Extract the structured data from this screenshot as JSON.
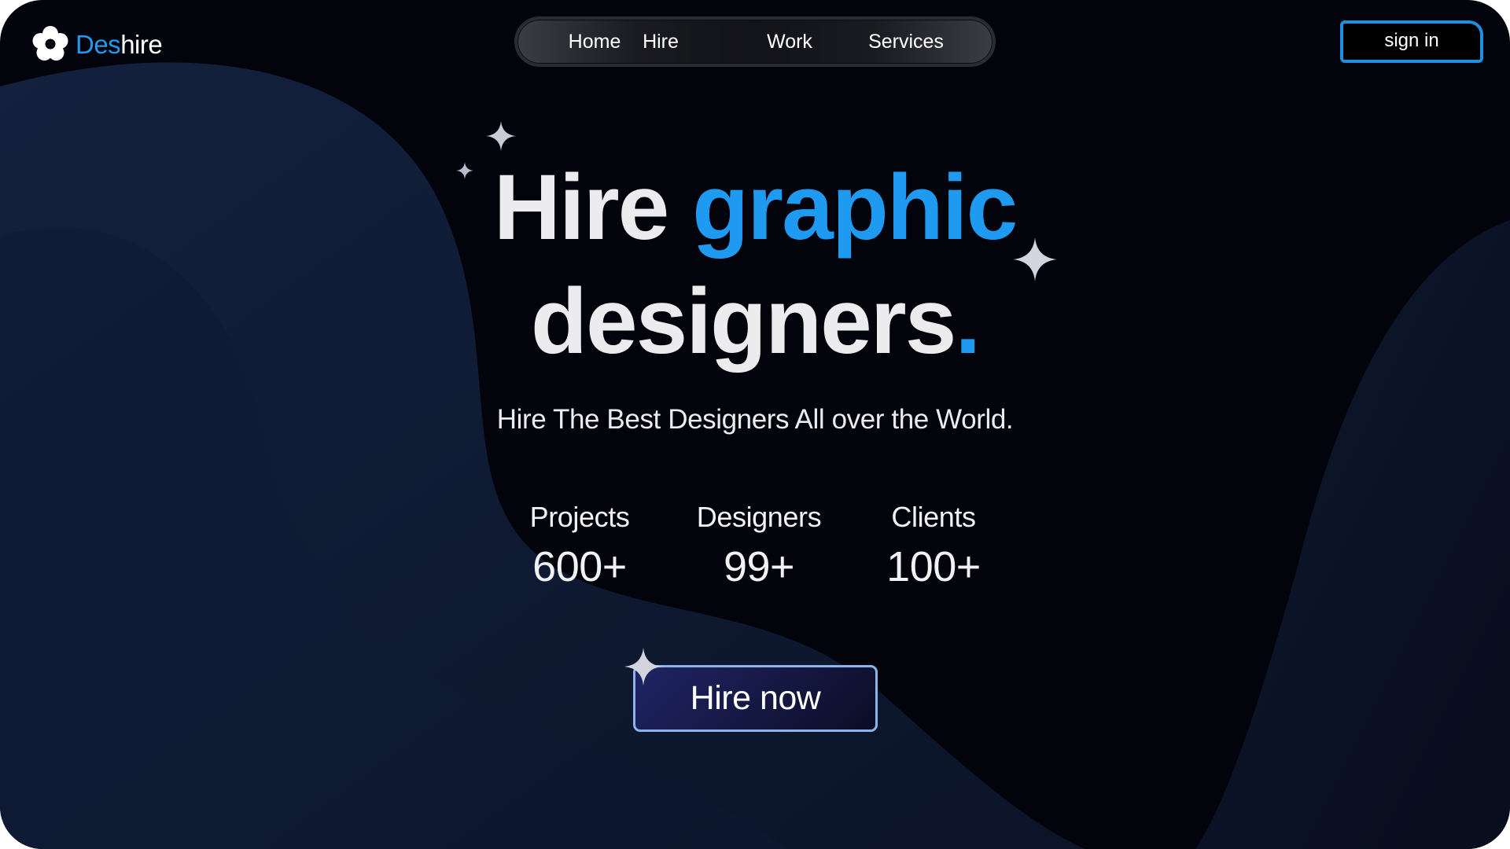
{
  "brand": {
    "name_accent": "Des",
    "name_rest": "hire",
    "accent_color": "#1e9bf0",
    "logo_icon": "flower-logo-icon"
  },
  "nav": {
    "items": [
      {
        "label": "Home"
      },
      {
        "label": "Hire"
      },
      {
        "label": "Work"
      },
      {
        "label": "Services"
      }
    ]
  },
  "header": {
    "signin_label": "sign in",
    "signin_border_color": "#1f8fe0"
  },
  "hero": {
    "line1_white": "Hire ",
    "line1_blue": "graphic",
    "line2_white": "designers",
    "line2_blue": ".",
    "tagline": "Hire The Best Designers All over the World."
  },
  "stats": [
    {
      "label": "Projects",
      "value": "600+"
    },
    {
      "label": "Designers",
      "value": "99+"
    },
    {
      "label": "Clients",
      "value": "100+"
    }
  ],
  "cta": {
    "label": "Hire now"
  },
  "decor": {
    "sparkle_icon": "four-point-sparkle-icon",
    "background_color": "#02030b"
  }
}
